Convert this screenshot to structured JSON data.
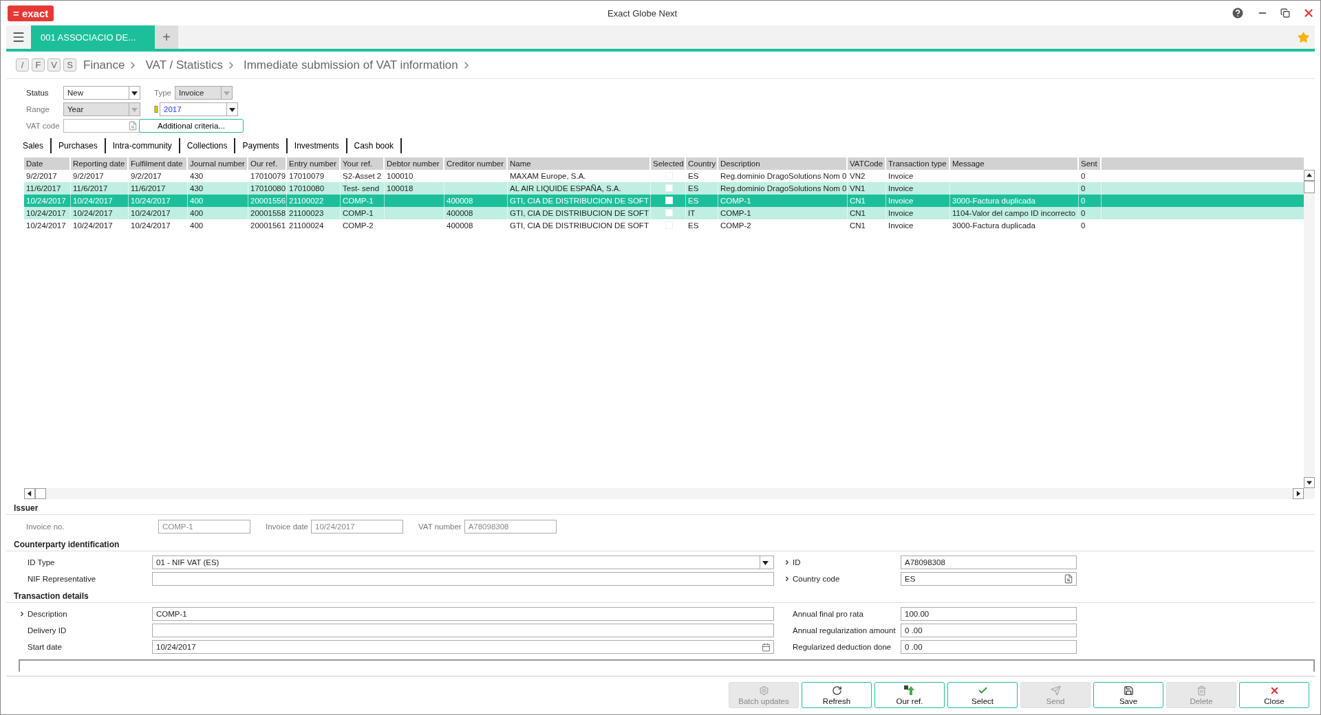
{
  "window": {
    "logo": "= exact",
    "title": "Exact Globe Next"
  },
  "company_tab": {
    "label": "001  ASSOCIACIO DE...",
    "selected": true
  },
  "new_tab": "+",
  "breadcrumb": {
    "keys": [
      "/",
      "F",
      "V",
      "S"
    ],
    "items": [
      "Finance",
      "VAT / Statistics",
      "Immediate submission of VAT information"
    ]
  },
  "filters": {
    "status": {
      "label": "Status",
      "value": "New",
      "disabled": false
    },
    "type": {
      "label": "Type",
      "value": "Invoice",
      "disabled": true
    },
    "range": {
      "label": "Range",
      "value": "Year",
      "disabled": true
    },
    "year": {
      "value": "2017",
      "disabled": false
    },
    "vat_code": {
      "label": "VAT code"
    },
    "additional_criteria": "Additional criteria..."
  },
  "tabs": [
    "Sales",
    "Purchases",
    "Intra-community",
    "Collections",
    "Payments",
    "Investments",
    "Cash book"
  ],
  "table": {
    "columns": [
      {
        "label": "Date",
        "kind": "text"
      },
      {
        "label": "Reporting date",
        "kind": "text"
      },
      {
        "label": "Fulfilment date",
        "kind": "text"
      },
      {
        "label": "Journal number",
        "kind": "text"
      },
      {
        "label": "Our ref.",
        "kind": "text"
      },
      {
        "label": "Entry number",
        "kind": "text"
      },
      {
        "label": "Your ref.",
        "kind": "text"
      },
      {
        "label": "Debtor number",
        "kind": "text"
      },
      {
        "label": "Creditor number",
        "kind": "text"
      },
      {
        "label": "Name",
        "kind": "text"
      },
      {
        "label": "Selected",
        "kind": "checkbox"
      },
      {
        "label": "Country",
        "kind": "text"
      },
      {
        "label": "Description",
        "kind": "text"
      },
      {
        "label": "VATCode",
        "kind": "text"
      },
      {
        "label": "Transaction type",
        "kind": "text"
      },
      {
        "label": "Message",
        "kind": "text"
      },
      {
        "label": "Sent",
        "kind": "text"
      }
    ],
    "rows": [
      {
        "selected": false,
        "highlighted": false,
        "cells": [
          "9/2/2017",
          "9/2/2017",
          "9/2/2017",
          "430",
          "17010079",
          "17010079",
          "S2-Asset 2",
          "100010",
          null,
          "MAXAM Europe, S.A.",
          null,
          "ES",
          "Reg.dominio DragoSolutions Nom 0",
          "VN2",
          "Invoice",
          null,
          "0"
        ]
      },
      {
        "selected": false,
        "highlighted": true,
        "cells": [
          "11/6/2017",
          "11/6/2017",
          "11/6/2017",
          "430",
          "17010080",
          "17010080",
          "Test- send",
          "100018",
          null,
          "AL AIR LIQUIDE ESPAÑA, S.A.",
          null,
          "ES",
          "Reg.dominio DragoSolutions Nom 0",
          "VN1",
          "Invoice",
          null,
          "0"
        ]
      },
      {
        "selected": true,
        "highlighted": false,
        "cells": [
          "10/24/2017",
          "10/24/2017",
          "10/24/2017",
          "400",
          "20001556",
          "21100022",
          "COMP-1",
          null,
          "400008",
          "GTI, CIA DE DISTRIBUCION DE SOFT",
          null,
          "ES",
          "COMP-1",
          "CN1",
          "Invoice",
          "3000-Factura duplicada",
          "0"
        ]
      },
      {
        "selected": false,
        "highlighted": true,
        "cells": [
          "10/24/2017",
          "10/24/2017",
          "10/24/2017",
          "400",
          "20001558",
          "21100023",
          "COMP-1",
          null,
          "400008",
          "GTI, CIA DE DISTRIBUCION DE SOFT",
          null,
          "IT",
          "COMP-1",
          "CN1",
          "Invoice",
          "1104-Valor del campo ID incorrecto",
          "0"
        ]
      },
      {
        "selected": false,
        "highlighted": false,
        "cells": [
          "10/24/2017",
          "10/24/2017",
          "10/24/2017",
          "400",
          "20001561",
          "21100024",
          "COMP-2",
          null,
          "400008",
          "GTI, CIA DE DISTRIBUCION DE SOFT",
          null,
          "ES",
          "COMP-2",
          "CN1",
          "Invoice",
          "3000-Factura duplicada",
          "0"
        ]
      }
    ]
  },
  "issuer": {
    "title": "Issuer",
    "fields": [
      {
        "label": "Invoice no.",
        "value": "COMP-1"
      },
      {
        "label": "Invoice date",
        "value": "10/24/2017"
      },
      {
        "label": "VAT number",
        "value": "A78098308"
      }
    ]
  },
  "counterparty": {
    "title": "Counterparty identification",
    "left": [
      {
        "label": "ID Type",
        "value": "01 - NIF VAT (ES)",
        "kind": "dropdown",
        "expandable": false
      },
      {
        "label": "NIF Representative",
        "kind": "text",
        "expandable": false
      }
    ],
    "right": [
      {
        "label": "ID",
        "value": "A78098308",
        "kind": "text",
        "expandable": true
      },
      {
        "label": "Country code",
        "value": "ES",
        "kind": "lookup",
        "expandable": true
      }
    ]
  },
  "transaction": {
    "title": "Transaction details",
    "left": [
      {
        "label": "Description",
        "value": "COMP-1",
        "kind": "text",
        "expandable": true
      },
      {
        "label": "Delivery ID",
        "kind": "text",
        "expandable": false
      },
      {
        "label": "Start date",
        "value": "10/24/2017",
        "kind": "date",
        "expandable": false
      }
    ],
    "right": [
      {
        "label": "Annual final pro rata",
        "value": "100.00",
        "kind": "text",
        "expandable": false
      },
      {
        "label": "Annual regularization amount",
        "value": "0 .00",
        "kind": "text",
        "expandable": false
      },
      {
        "label": "Regularized deduction done",
        "value": "0 .00",
        "kind": "text",
        "expandable": false
      }
    ]
  },
  "buttons": [
    {
      "label": "Batch updates",
      "kind": "gear",
      "disabled": true
    },
    {
      "label": "Refresh",
      "kind": "refresh",
      "disabled": false
    },
    {
      "label": "Our ref.",
      "kind": "ref",
      "disabled": false
    },
    {
      "label": "Select",
      "kind": "check",
      "disabled": false
    },
    {
      "label": "Send",
      "kind": "send",
      "disabled": true
    },
    {
      "label": "Save",
      "kind": "save",
      "disabled": false
    },
    {
      "label": "Delete",
      "kind": "delete",
      "disabled": true
    },
    {
      "label": "Close",
      "kind": "close",
      "disabled": false
    }
  ]
}
